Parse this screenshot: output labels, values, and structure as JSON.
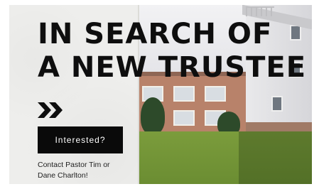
{
  "flyer": {
    "headline_line1": "IN SEARCH OF",
    "headline_line2": "A NEW TRUSTEE",
    "arrow_icon": "double-chevron-right-icon",
    "cta_label": "Interested?",
    "contact_line1": "Contact Pastor Tim or",
    "contact_line2": "Dane Charlton!"
  },
  "colors": {
    "text": "#0e0e0e",
    "button_bg": "#0a0a0a",
    "button_text": "#ffffff",
    "paper": "#eeeeec"
  }
}
